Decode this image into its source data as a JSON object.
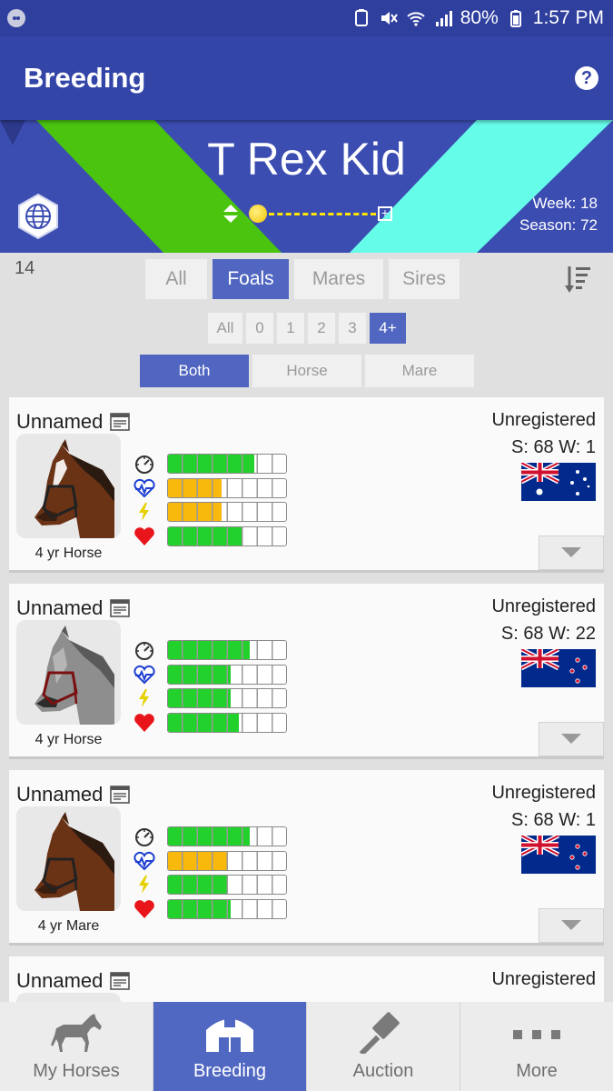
{
  "status_bar": {
    "battery": "80%",
    "time": "1:57 PM"
  },
  "app_bar": {
    "title": "Breeding",
    "help_icon": "help-circle-icon"
  },
  "banner": {
    "farm_name": "T Rex Kid",
    "week_label": "Week: 18",
    "season_label": "Season: 72",
    "colors": {
      "green": "#4ac40f",
      "cyan": "#66fcea",
      "blue": "#3c4db2"
    }
  },
  "filters": {
    "count": "14",
    "tabs": [
      "All",
      "Foals",
      "Mares",
      "Sires"
    ],
    "active_tab": "Foals",
    "ages": [
      "All",
      "0",
      "1",
      "2",
      "3",
      "4+"
    ],
    "active_age": "4+",
    "sexes": [
      "Both",
      "Horse",
      "Mare"
    ],
    "active_sex": "Both"
  },
  "horses": [
    {
      "name": "Unnamed",
      "status": "Unregistered",
      "sw": "S: 68 W: 1",
      "age_label": "4 yr Horse",
      "flag": "australia",
      "coat": "bay",
      "stats": [
        {
          "icon": "speedometer-icon",
          "value": 0.73,
          "color": "#22d12b"
        },
        {
          "icon": "stamina-heart-icon",
          "value": 0.45,
          "color": "#f9b80c"
        },
        {
          "icon": "lightning-icon",
          "value": 0.45,
          "color": "#f9b80c"
        },
        {
          "icon": "heart-icon",
          "value": 0.62,
          "color": "#22d12b"
        }
      ]
    },
    {
      "name": "Unnamed",
      "status": "Unregistered",
      "sw": "S: 68 W: 22",
      "age_label": "4 yr Horse",
      "flag": "new-zealand",
      "coat": "grey",
      "stats": [
        {
          "icon": "speedometer-icon",
          "value": 0.69,
          "color": "#22d12b"
        },
        {
          "icon": "stamina-heart-icon",
          "value": 0.53,
          "color": "#22d12b"
        },
        {
          "icon": "lightning-icon",
          "value": 0.53,
          "color": "#22d12b"
        },
        {
          "icon": "heart-icon",
          "value": 0.6,
          "color": "#22d12b"
        }
      ]
    },
    {
      "name": "Unnamed",
      "status": "Unregistered",
      "sw": "S: 68 W: 1",
      "age_label": "4 yr Mare",
      "flag": "new-zealand",
      "coat": "bay",
      "stats": [
        {
          "icon": "speedometer-icon",
          "value": 0.69,
          "color": "#22d12b"
        },
        {
          "icon": "stamina-heart-icon",
          "value": 0.5,
          "color": "#f9b80c"
        },
        {
          "icon": "lightning-icon",
          "value": 0.5,
          "color": "#22d12b"
        },
        {
          "icon": "heart-icon",
          "value": 0.53,
          "color": "#22d12b"
        }
      ]
    },
    {
      "name": "Unnamed",
      "status": "Unregistered",
      "sw": "",
      "age_label": "",
      "flag": "",
      "coat": "bay",
      "stats": []
    }
  ],
  "bottom_nav": [
    {
      "label": "My Horses",
      "icon": "horse-icon"
    },
    {
      "label": "Breeding",
      "icon": "barn-icon",
      "active": true
    },
    {
      "label": "Auction",
      "icon": "gavel-icon"
    },
    {
      "label": "More",
      "icon": "more-dots-icon"
    }
  ]
}
